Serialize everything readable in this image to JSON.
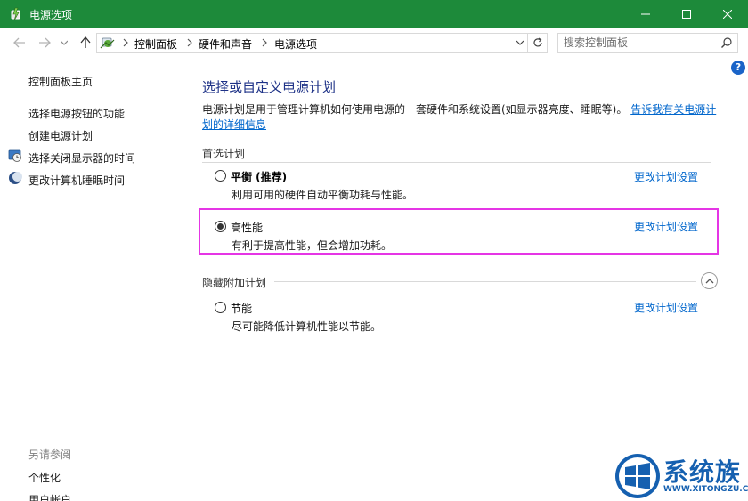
{
  "window": {
    "title": "电源选项",
    "colors": {
      "titlebar": "#1d8a3a",
      "link": "#0066cc",
      "heading": "#1e3287",
      "highlight": "#e535e5"
    }
  },
  "nav": {
    "breadcrumbs": [
      "控制面板",
      "硬件和声音",
      "电源选项"
    ],
    "search_placeholder": "搜索控制面板"
  },
  "sidebar": {
    "home": "控制面板主页",
    "items": [
      {
        "label": "选择电源按钮的功能",
        "icon": ""
      },
      {
        "label": "创建电源计划",
        "icon": ""
      },
      {
        "label": "选择关闭显示器的时间",
        "icon": "monitor-clock-icon"
      },
      {
        "label": "更改计算机睡眠时间",
        "icon": "moon-icon"
      }
    ],
    "see_also_title": "另请参阅",
    "see_also": [
      "个性化",
      "用户帐户"
    ]
  },
  "main": {
    "title": "选择或自定义电源计划",
    "description": "电源计划是用于管理计算机如何使用电源的一套硬件和系统设置(如显示器亮度、睡眠等)。",
    "description_link": "告诉我有关电源计划的详细信息",
    "preferred_label": "首选计划",
    "hidden_label": "隐藏附加计划",
    "plans": [
      {
        "name": "平衡 (推荐)",
        "desc": "利用可用的硬件自动平衡功耗与性能。",
        "selected": false,
        "link": "更改计划设置"
      },
      {
        "name": "高性能",
        "desc": "有利于提高性能，但会增加功耗。",
        "selected": true,
        "link": "更改计划设置"
      },
      {
        "name": "节能",
        "desc": "尽可能降低计算机性能以节能。",
        "selected": false,
        "link": "更改计划设置"
      }
    ]
  },
  "watermark": {
    "title": "系统族",
    "url": "WWW.XITONGZU.COM"
  }
}
